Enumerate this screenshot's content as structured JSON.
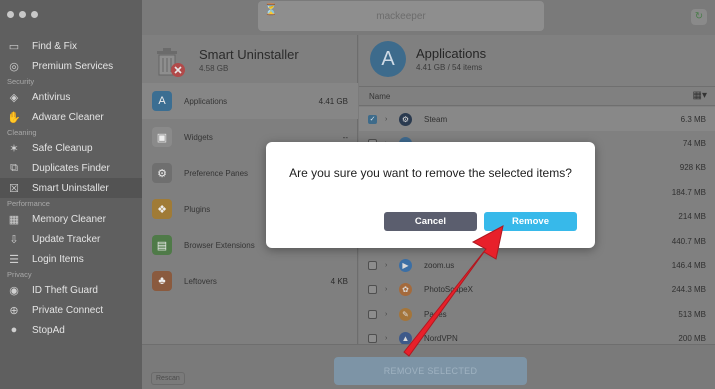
{
  "sidebar": {
    "items": [
      {
        "label": "Find & Fix",
        "icon": "monitor-icon"
      },
      {
        "label": "Premium Services",
        "icon": "chat-icon"
      },
      {
        "section": "Security"
      },
      {
        "label": "Antivirus",
        "icon": "shield-icon"
      },
      {
        "label": "Adware Cleaner",
        "icon": "hand-icon"
      },
      {
        "section": "Cleaning"
      },
      {
        "label": "Safe Cleanup",
        "icon": "broom-icon"
      },
      {
        "label": "Duplicates Finder",
        "icon": "duplicates-icon"
      },
      {
        "label": "Smart Uninstaller",
        "icon": "uninstaller-icon",
        "active": true
      },
      {
        "section": "Performance"
      },
      {
        "label": "Memory Cleaner",
        "icon": "memory-icon"
      },
      {
        "label": "Update Tracker",
        "icon": "download-icon"
      },
      {
        "label": "Login Items",
        "icon": "list-icon"
      },
      {
        "section": "Privacy"
      },
      {
        "label": "ID Theft Guard",
        "icon": "fingerprint-icon"
      },
      {
        "label": "Private Connect",
        "icon": "globe-icon"
      },
      {
        "label": "StopAd",
        "icon": "stop-icon"
      }
    ]
  },
  "topbar": {
    "logo": "mackeeper"
  },
  "uninstaller": {
    "title": "Smart Uninstaller",
    "size": "4.58 GB",
    "categories": [
      {
        "label": "Applications",
        "size": "4.41 GB",
        "icon": "appstore-icon",
        "color": "#3b6e92",
        "active": true
      },
      {
        "label": "Widgets",
        "size": "--",
        "icon": "widgets-icon",
        "color": "#8a8a8a"
      },
      {
        "label": "Preference Panes",
        "size": "",
        "icon": "gear-icon",
        "color": "#6f6f6f"
      },
      {
        "label": "Plugins",
        "size": "",
        "icon": "puzzle-icon",
        "color": "#a07b36"
      },
      {
        "label": "Browser Extensions",
        "size": "",
        "icon": "extensions-icon",
        "color": "#4f7a48"
      },
      {
        "label": "Leftovers",
        "size": "4 KB",
        "icon": "apple-core-icon",
        "color": "#8a5a3e"
      }
    ]
  },
  "applications": {
    "title": "Applications",
    "subtitle": "4.41 GB / 54 items",
    "column_name": "Name",
    "rows": [
      {
        "name": "Steam",
        "size": "6.3 MB",
        "checked": true,
        "icon": "steam-icon",
        "color": "#2a3a4f"
      },
      {
        "name": "",
        "size": "74 MB",
        "checked": false,
        "icon": "app-icon",
        "color": "#3f6a8f"
      },
      {
        "name": "",
        "size": "928 KB",
        "checked": false,
        "icon": "app-icon",
        "color": "#6a6a6a"
      },
      {
        "name": "",
        "size": "184.7 MB",
        "checked": false,
        "icon": "app-icon",
        "color": "#6a6a6a"
      },
      {
        "name": "",
        "size": "214 MB",
        "checked": false,
        "icon": "app-icon",
        "color": "#6a6a6a"
      },
      {
        "name": "",
        "size": "440.7 MB",
        "checked": false,
        "icon": "app-icon",
        "color": "#6a6a6a"
      },
      {
        "name": "zoom.us",
        "size": "146.4 MB",
        "checked": false,
        "icon": "zoom-icon",
        "color": "#3b6fa5"
      },
      {
        "name": "PhotoScapeX",
        "size": "244.3 MB",
        "checked": false,
        "icon": "photoscape-icon",
        "color": "#a46a3c"
      },
      {
        "name": "Pages",
        "size": "513 MB",
        "checked": false,
        "icon": "pages-icon",
        "color": "#a4753a"
      },
      {
        "name": "NordVPN",
        "size": "200 MB",
        "checked": false,
        "icon": "nordvpn-icon",
        "color": "#3e5a8a"
      }
    ]
  },
  "bottom": {
    "rescan": "Rescan",
    "remove_selected": "REMOVE SELECTED"
  },
  "dialog": {
    "question": "Are you sure you want to remove the selected items?",
    "cancel": "Cancel",
    "remove": "Remove"
  },
  "annotation": {
    "arrow_color": "#e8202a"
  }
}
